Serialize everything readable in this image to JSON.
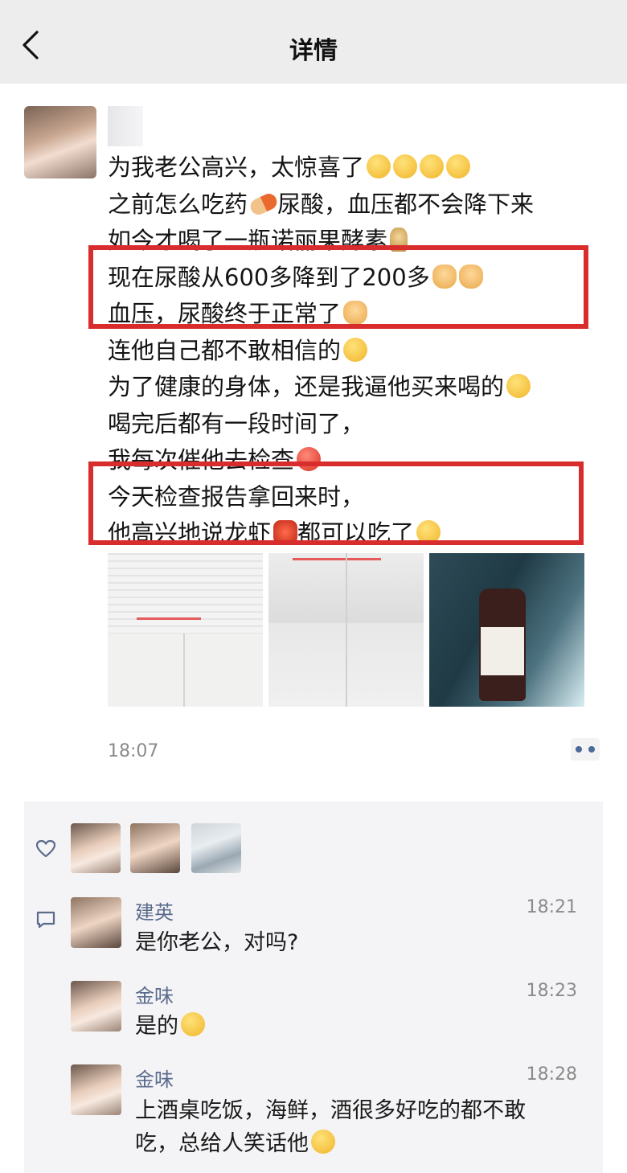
{
  "header": {
    "title": "详情"
  },
  "post": {
    "lines": [
      "为我老公高兴，太惊喜了",
      "之前怎么吃药",
      "尿酸，血压都不会降下来",
      "如今才喝了一瓶诺丽果酵素",
      "现在尿酸从600多降到了200多",
      "血压，尿酸终于正常了",
      "连他自己都不敢相信的",
      "为了健康的身体，还是我逼他买来喝的",
      "喝完后都有一段时间了，",
      "我每次催他去检查",
      "今天检查报告拿回来时，",
      "他高兴地说龙虾",
      "都可以吃了"
    ],
    "time": "18:07",
    "highlight_color": "#d92c2c"
  },
  "likes": {
    "icon": "heart-icon"
  },
  "comments": [
    {
      "name": "建英",
      "time": "18:21",
      "text": "是你老公，对吗?"
    },
    {
      "name": "金味",
      "time": "18:23",
      "text": "是的"
    },
    {
      "name": "金味",
      "time": "18:28",
      "text": "上酒桌吃饭，海鲜，酒很多好吃的都不敢吃，总给人笑话他"
    }
  ],
  "colors": {
    "header_bg": "#ededed",
    "panel_bg": "#f4f4f6",
    "name_color": "#5b6b8c"
  }
}
